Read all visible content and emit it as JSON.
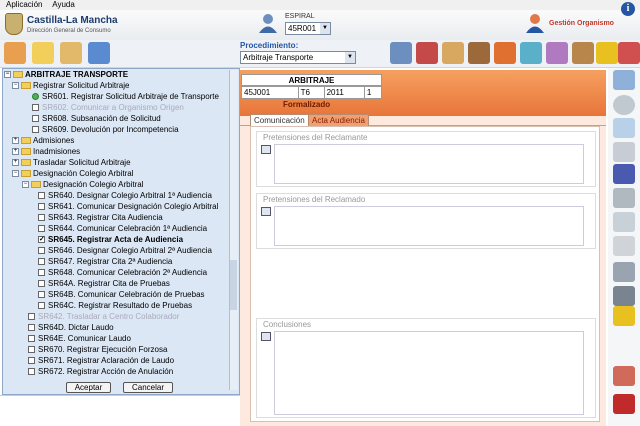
{
  "menu": {
    "items": [
      "Aplicación",
      "Ayuda"
    ]
  },
  "header": {
    "logo_title": "Castilla-La Mancha",
    "logo_subtitle": "Dirección General de Consumo",
    "espiral_label": "ESPIRAL",
    "espiral_value": "45R001",
    "org_label": "Gestión Organismo"
  },
  "procedure": {
    "label": "Procedimiento:",
    "value": "Arbitraje Transporte"
  },
  "arbitraje": {
    "title": "ARBITRAJE",
    "cells": [
      "45J001",
      "T6",
      "2011",
      "1"
    ],
    "status": "Formalizado"
  },
  "tabs": [
    {
      "label": "Comunicación"
    },
    {
      "label": "Acta Audiencia"
    }
  ],
  "sections": [
    {
      "label": "Pretensiones del Reclamante"
    },
    {
      "label": "Pretensiones del Reclamado"
    },
    {
      "label": "Conclusiones"
    }
  ],
  "tree": {
    "root": "ARBITRAJE TRANSPORTE",
    "nodes": [
      {
        "label": "Registrar Solicitud Arbitraje"
      },
      {
        "label": "SR601. Registrar Solicitud Arbitraje de Transporte"
      },
      {
        "label": "SR602. Comunicar a Organismo Origen"
      },
      {
        "label": "SR608. Subsanación de Solicitud"
      },
      {
        "label": "SR609. Devolución por Incompetencia"
      },
      {
        "label": "Admisiones"
      },
      {
        "label": "Inadmisiones"
      },
      {
        "label": "Trasladar Solicitud Arbitraje"
      },
      {
        "label": "Designación Colegio Arbitral"
      },
      {
        "label": "Designación Colegio Arbitral"
      },
      {
        "label": "SR640. Designar Colegio Arbitral 1ª Audiencia"
      },
      {
        "label": "SR641. Comunicar Designación Colegio Arbitral"
      },
      {
        "label": "SR643. Registrar Cita Audiencia"
      },
      {
        "label": "SR644. Comunicar Celebración 1ª Audiencia"
      },
      {
        "label": "SR645. Registrar Acta de Audiencia"
      },
      {
        "label": "SR646. Designar Colegio Arbitral 2ª Audiencia"
      },
      {
        "label": "SR647. Registrar Cita 2ª Audiencia"
      },
      {
        "label": "SR648. Comunicar Celebración 2ª Audiencia"
      },
      {
        "label": "SR64A. Registrar Cita de Pruebas"
      },
      {
        "label": "SR64B. Comunicar Celebración de Pruebas"
      },
      {
        "label": "SR64C. Registrar Resultado de Pruebas"
      },
      {
        "label": "SR642. Trasladar a Centro Colaborador"
      },
      {
        "label": "SR64D. Dictar Laudo"
      },
      {
        "label": "SR64E. Comunicar Laudo"
      },
      {
        "label": "SR670. Registrar Ejecución Forzosa"
      },
      {
        "label": "SR671. Registrar Aclaración de Laudo"
      },
      {
        "label": "SR672. Registrar Acción de Anulación"
      }
    ]
  },
  "buttons": {
    "accept": "Aceptar",
    "cancel": "Cancelar"
  }
}
